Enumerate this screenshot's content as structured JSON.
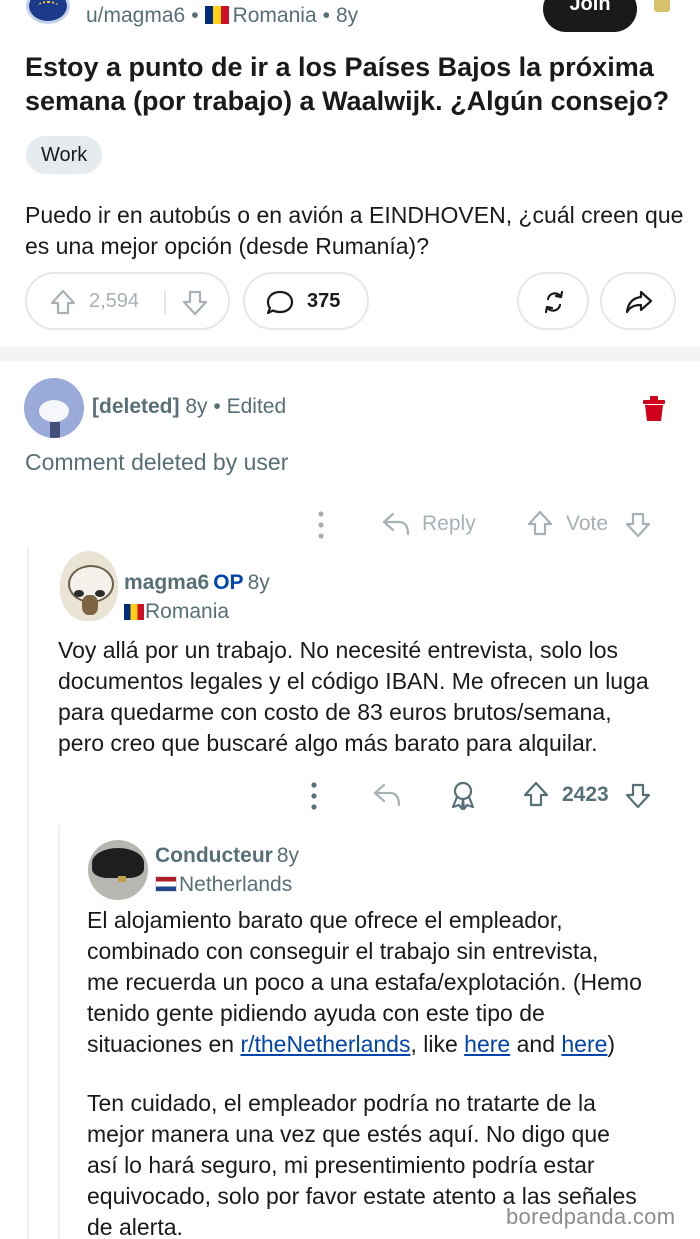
{
  "post": {
    "author": "u/magma6",
    "country": "Romania",
    "age": "8y",
    "join_label": "Join",
    "title": "Estoy a punto de ir a los Países Bajos la próxima semana (por trabajo) a Waalwijk. ¿Algún consejo?",
    "flair": "Work",
    "body": "Puedo ir en autobús o en avión a EINDHOVEN, ¿cuál creen que es una mejor opción (desde Rumanía)?",
    "upvotes": "2,594",
    "comments": "375",
    "icons": [
      "upvote-icon",
      "downvote-icon",
      "comment-icon",
      "crosspost-icon",
      "share-icon"
    ]
  },
  "comments": [
    {
      "user": "[deleted]",
      "age": "8y",
      "edited": "Edited",
      "text": "Comment deleted by user",
      "reply_label": "Reply",
      "vote_label": "Vote"
    },
    {
      "user": "magma6",
      "op": "OP",
      "age": "8y",
      "country": "Romania",
      "lines": [
        "Voy allá por un trabajo. No necesité entrevista, solo los",
        "documentos legales y el código IBAN. Me ofrecen un luga",
        "para quedarme con costo de 83 euros brutos/semana,",
        "pero creo que buscaré algo más barato para alquilar."
      ],
      "score": "2423"
    },
    {
      "user": "Conducteur",
      "age": "8y",
      "country": "Netherlands",
      "para1_lines": [
        "El alojamiento barato que ofrece el empleador,",
        "combinado con conseguir el trabajo sin entrevista,",
        "me recuerda un poco a una estafa/explotación. (Hemo",
        "tenido gente pidiendo ayuda con este tipo de"
      ],
      "para1_last_prefix": "situaciones en ",
      "subreddit_link": "r/theNetherlands",
      "like_text": ", like ",
      "link1": "here",
      "and_text": " and ",
      "link2": "here",
      "close_paren": ")",
      "para2_lines": [
        "Ten cuidado, el empleador podría no tratarte de la",
        "mejor manera una vez que estés aquí. No digo que",
        "así lo hará seguro, mi presentimiento podría estar",
        "equivocado, solo por favor estate atento a las señales",
        "de alerta."
      ]
    }
  ],
  "watermark": "boredpanda.com",
  "colors": {
    "link": "#0045ac",
    "muted": "#576f76",
    "delete": "#d0021b",
    "join_bg": "#1a1a1b"
  }
}
